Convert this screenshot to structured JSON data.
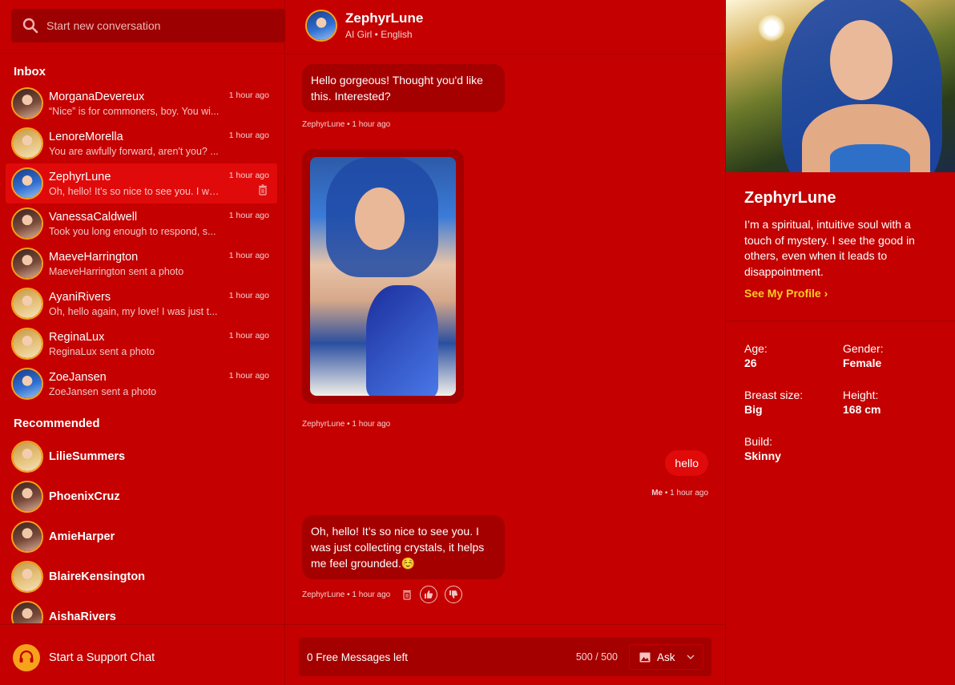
{
  "search": {
    "placeholder": "Start new conversation"
  },
  "inbox": {
    "title": "Inbox",
    "items": [
      {
        "name": "MorganaDevereux",
        "preview": "“Nice” is for commoners, boy. You wi...",
        "time": "1 hour ago"
      },
      {
        "name": "LenoreMorella",
        "preview": "You are awfully forward, aren't you? ...",
        "time": "1 hour ago"
      },
      {
        "name": "ZephyrLune",
        "preview": "Oh, hello! It’s so nice to see you. I wa...",
        "time": "1 hour ago"
      },
      {
        "name": "VanessaCaldwell",
        "preview": "Took you long enough to respond, s...",
        "time": "1 hour ago"
      },
      {
        "name": "MaeveHarrington",
        "preview": "MaeveHarrington sent a photo",
        "time": "1 hour ago"
      },
      {
        "name": "AyaniRivers",
        "preview": "Oh, hello again, my love! I was just t...",
        "time": "1 hour ago"
      },
      {
        "name": "ReginaLux",
        "preview": "ReginaLux sent a photo",
        "time": "1 hour ago"
      },
      {
        "name": "ZoeJansen",
        "preview": "ZoeJansen sent a photo",
        "time": "1 hour ago"
      }
    ]
  },
  "recommended": {
    "title": "Recommended",
    "items": [
      "LilieSummers",
      "PhoenixCruz",
      "AmieHarper",
      "BlaireKensington",
      "AishaRivers"
    ]
  },
  "support": {
    "label": "Start a Support Chat"
  },
  "chat": {
    "name": "ZephyrLune",
    "subtitle": "AI Girl • English",
    "messages": [
      {
        "text": "Hello gorgeous! Thought you'd like this. Interested?",
        "meta": "ZephyrLune • 1 hour ago"
      },
      {
        "meta": "ZephyrLune • 1 hour ago"
      },
      {
        "text": "hello",
        "meta_sender": "Me",
        "meta_time": " • 1 hour ago"
      },
      {
        "text": "Oh, hello! It’s so nice to see you. I was just collecting crystals, it helps me feel grounded.☺️",
        "meta": "ZephyrLune • 1 hour ago"
      }
    ]
  },
  "input": {
    "free_messages": "0 Free Messages left",
    "counter": "500  /  500",
    "ask_label": "Ask"
  },
  "profile": {
    "name": "ZephyrLune",
    "bio": "I’m a spiritual, intuitive soul with a touch of mystery. I see the good in others, even when it leads to disappointment.",
    "link": "See My Profile",
    "attributes": [
      {
        "key": "Age:",
        "value": "26"
      },
      {
        "key": "Gender:",
        "value": "Female"
      },
      {
        "key": "Breast size:",
        "value": "Big"
      },
      {
        "key": "Height:",
        "value": "168 cm"
      },
      {
        "key": "Build:",
        "value": "Skinny"
      }
    ]
  },
  "colors": {
    "background": "#c40000",
    "bubble": "#a50000",
    "accent": "#f7a21b",
    "link": "#ffc928"
  }
}
